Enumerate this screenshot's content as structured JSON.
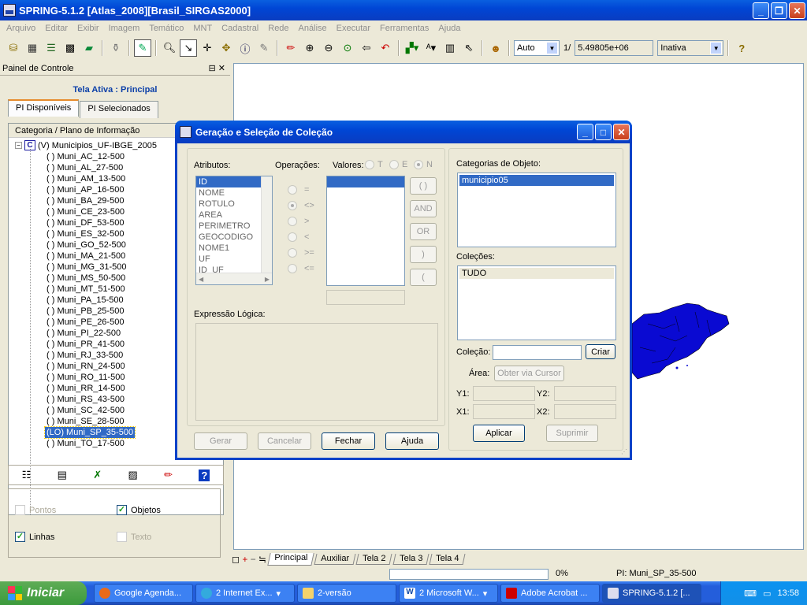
{
  "window": {
    "title": "SPRING-5.1.2 [Atlas_2008][Brasil_SIRGAS2000]"
  },
  "menu": [
    "Arquivo",
    "Editar",
    "Exibir",
    "Imagem",
    "Temático",
    "MNT",
    "Cadastral",
    "Rede",
    "Análise",
    "Executar",
    "Ferramentas",
    "Ajuda"
  ],
  "toolbar": {
    "scale_mode": "Auto",
    "scale_prefix": "1/",
    "scale_value": "5.49805e+06",
    "state": "Inativa"
  },
  "panel": {
    "title": "Painel de Controle",
    "active_screen": "Tela Ativa : Principal",
    "tab_available": "PI Disponíveis",
    "tab_selected": "PI Selecionados",
    "tree_header": "Categoria / Plano de Informação",
    "root_letter": "C",
    "root": "(V) Municipios_UF-IBGE_2005",
    "items": [
      "( ) Muni_AC_12-500",
      "( ) Muni_AL_27-500",
      "( ) Muni_AM_13-500",
      "( ) Muni_AP_16-500",
      "( ) Muni_BA_29-500",
      "( ) Muni_CE_23-500",
      "( ) Muni_DF_53-500",
      "( ) Muni_ES_32-500",
      "( ) Muni_GO_52-500",
      "( ) Muni_MA_21-500",
      "( ) Muni_MG_31-500",
      "( ) Muni_MS_50-500",
      "( ) Muni_MT_51-500",
      "( ) Muni_PA_15-500",
      "( ) Muni_PB_25-500",
      "( ) Muni_PE_26-500",
      "( ) Muni_PI_22-500",
      "( ) Muni_PR_41-500",
      "( ) Muni_RJ_33-500",
      "( ) Muni_RN_24-500",
      "( ) Muni_RO_11-500",
      "( ) Muni_RR_14-500",
      "( ) Muni_RS_43-500",
      "( ) Muni_SC_42-500",
      "( ) Muni_SE_28-500",
      "(LO) Muni_SP_35-500",
      "( ) Muni_TO_17-500"
    ],
    "selected_index": 25,
    "options": {
      "points": "Pontos",
      "objects": "Objetos",
      "lines": "Linhas",
      "text": "Texto"
    }
  },
  "dialog": {
    "title": "Geração e Seleção de Coleção",
    "attributes_label": "Atributos:",
    "attributes": [
      "ID",
      "NOME",
      "ROTULO",
      "AREA",
      "PERIMETRO",
      "GEOCODIGO",
      "NOME1",
      "UF",
      "ID_UF"
    ],
    "operations_label": "Operações:",
    "operations": [
      "=",
      "<>",
      ">",
      "<",
      ">=",
      "<="
    ],
    "values_label": "Valores:",
    "value_types": [
      "T",
      "E",
      "N"
    ],
    "logic_buttons": [
      "( )",
      "AND",
      "OR",
      ")",
      "("
    ],
    "expression_label": "Expressão Lógica:",
    "object_categories_label": "Categorias de Objeto:",
    "object_categories": [
      "municipio05"
    ],
    "collections_label": "Coleções:",
    "collections": [
      "TUDO"
    ],
    "collection_field_label": "Coleção:",
    "create_button": "Criar",
    "area_label": "Área:",
    "area_button": "Obter via Cursor",
    "y1": "Y1:",
    "y2": "Y2:",
    "x1": "X1:",
    "x2": "X2:",
    "apply_button": "Aplicar",
    "delete_button": "Suprimir",
    "generate_button": "Gerar",
    "cancel_button": "Cancelar",
    "close_button": "Fechar",
    "help_button": "Ajuda"
  },
  "screen_tabs": [
    "Principal",
    "Auxiliar",
    "Tela 2",
    "Tela 3",
    "Tela 4"
  ],
  "status": {
    "progress": "0%",
    "pi": "PI: Muni_SP_35-500"
  },
  "taskbar": {
    "start": "Iniciar",
    "tasks": [
      "Google Agenda...",
      "2 Internet Ex...",
      "2-versão",
      "2 Microsoft W...",
      "Adobe Acrobat ...",
      "SPRING-5.1.2 [..."
    ],
    "clock": "13:58"
  },
  "colors": {
    "map_fill": "#0a0ad2",
    "selection": "#316ac5",
    "xp_blue": "#0a5fe0"
  }
}
